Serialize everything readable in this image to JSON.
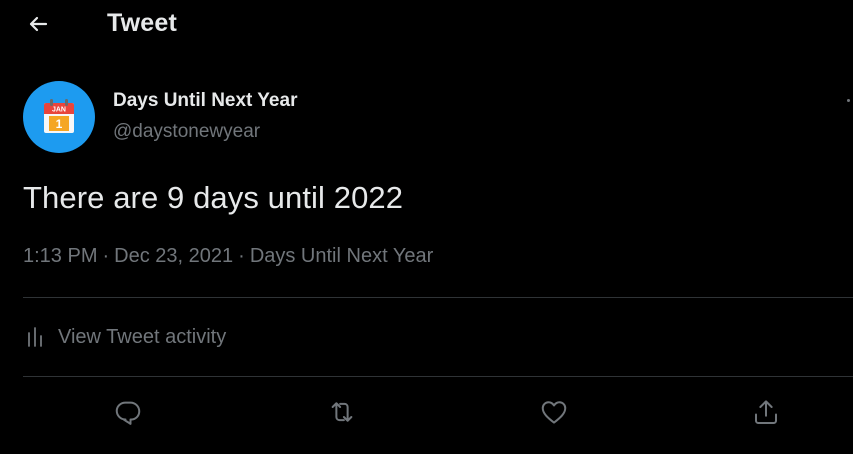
{
  "header": {
    "title": "Tweet",
    "back_icon": "arrow-left-icon"
  },
  "author": {
    "display_name": "Days Until Next Year",
    "handle": "@daystonewyear",
    "avatar": {
      "icon": "calendar-icon",
      "month": "JAN",
      "day": "1",
      "background_color": "#1d9bf0"
    }
  },
  "tweet": {
    "text": "There are 9 days until 2022",
    "time": "1:13 PM",
    "separator": "·",
    "date": "Dec 23, 2021",
    "source": "Days Until Next Year"
  },
  "activity": {
    "label": "View Tweet activity",
    "icon": "analytics-icon"
  },
  "actions": [
    {
      "name": "reply",
      "icon": "reply-icon"
    },
    {
      "name": "retweet",
      "icon": "retweet-icon"
    },
    {
      "name": "like",
      "icon": "heart-icon"
    },
    {
      "name": "share",
      "icon": "share-icon"
    }
  ],
  "colors": {
    "background": "#000000",
    "text_primary": "#e7e9ea",
    "text_secondary": "#71767b",
    "divider": "#2f3336",
    "accent": "#1d9bf0"
  }
}
